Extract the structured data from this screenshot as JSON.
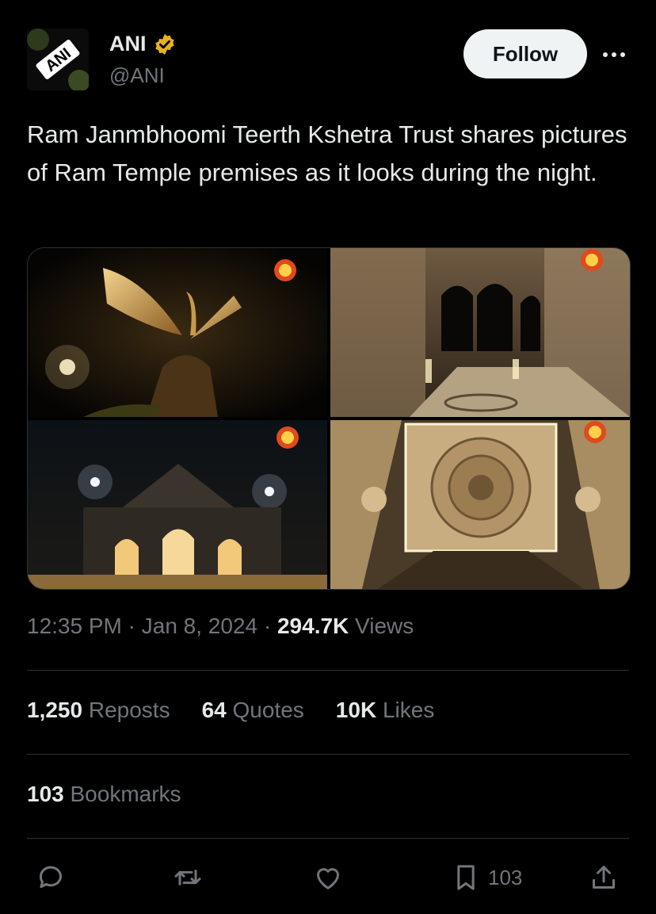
{
  "author": {
    "name": "ANI",
    "handle": "@ANI",
    "avatar_text": "ANI",
    "verified_color": "#e8b124"
  },
  "follow_label": "Follow",
  "tweet_text": "Ram Janmbhoomi Teerth Kshetra Trust shares pictures of Ram Temple premises as it looks during the night.",
  "media": [
    {
      "icon": "peacock-sculpture-photo"
    },
    {
      "icon": "temple-interior-corridor-photo"
    },
    {
      "icon": "temple-night-exterior-photo"
    },
    {
      "icon": "carved-ceiling-photo"
    }
  ],
  "meta": {
    "time": "12:35 PM",
    "sep1": " · ",
    "date": "Jan 8, 2024",
    "sep2": " · ",
    "views_count": "294.7K",
    "views_label": " Views"
  },
  "stats": {
    "reposts_count": "1,250",
    "reposts_label": " Reposts",
    "quotes_count": "64",
    "quotes_label": " Quotes",
    "likes_count": "10K",
    "likes_label": " Likes",
    "bookmarks_count": "103",
    "bookmarks_label": " Bookmarks"
  },
  "actions": {
    "bookmark_count": "103"
  },
  "colors": {
    "background": "#000000",
    "text": "#e7e9ea",
    "muted": "#71767b",
    "divider": "#2f3336",
    "follow_bg": "#eff3f4"
  }
}
